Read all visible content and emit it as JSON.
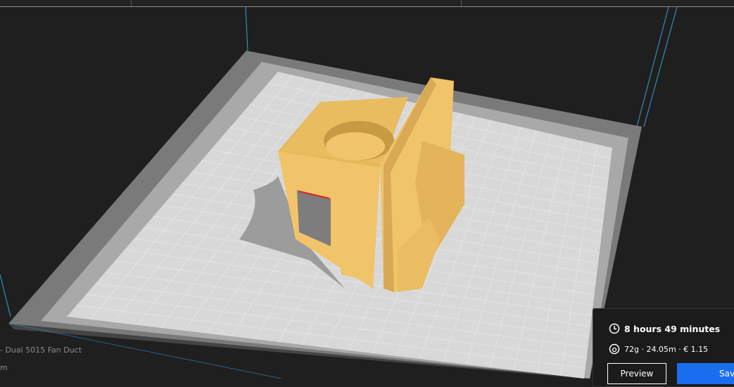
{
  "object": {
    "name": "- Dual 5015 Fan Duct",
    "dimensions": "m"
  },
  "print_info": {
    "time": "8 hours 49 minutes",
    "material": "72g · 24.05m · € 1.15",
    "icons": [
      "clock-icon",
      "filament-spool-icon"
    ]
  },
  "actions": {
    "preview": "Preview",
    "save": "Sav"
  },
  "colors": {
    "accent": "#196ef0",
    "model": "#f2c46a",
    "plate": "#d8d8d8",
    "edge": "#3aa0d8"
  }
}
